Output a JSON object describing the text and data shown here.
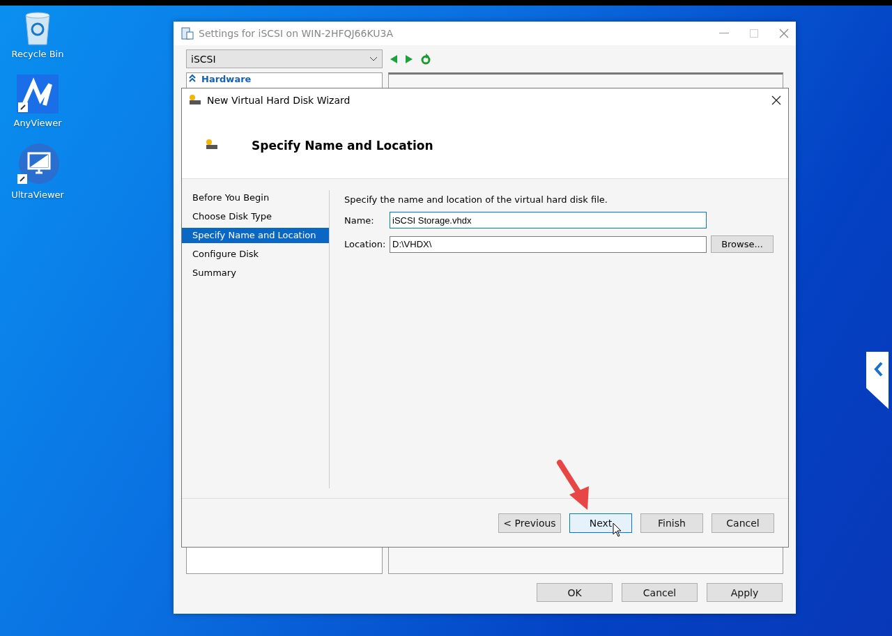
{
  "desktop_icons": [
    {
      "label": "Recycle Bin",
      "kind": "bin"
    },
    {
      "label": "AnyViewer",
      "kind": "anyviewer"
    },
    {
      "label": "UltraViewer",
      "kind": "ultraviewer"
    }
  ],
  "settings_window": {
    "title": "Settings for iSCSI on WIN-2HFQJ66KU3A",
    "selector": "iSCSI",
    "tree_heading": "Hardware",
    "buttons": [
      "OK",
      "Cancel",
      "Apply"
    ]
  },
  "wizard": {
    "title": "New Virtual Hard Disk Wizard",
    "heading": "Specify Name and Location",
    "steps": [
      {
        "label": "Before You Begin",
        "selected": false
      },
      {
        "label": "Choose Disk Type",
        "selected": false
      },
      {
        "label": "Specify Name and Location",
        "selected": true
      },
      {
        "label": "Configure Disk",
        "selected": false
      },
      {
        "label": "Summary",
        "selected": false
      }
    ],
    "instruction": "Specify the name and location of the virtual hard disk file.",
    "fields": [
      {
        "label": "Name:",
        "value": "iSCSI Storage.vhdx",
        "focused": true
      },
      {
        "label": "Location:",
        "value": "D:\\VHDX\\",
        "focused": false
      }
    ],
    "browse": "Browse...",
    "buttons": [
      {
        "label": "< Previous",
        "default": false
      },
      {
        "label": "Next",
        "default": true
      },
      {
        "label": "Finish",
        "default": false
      },
      {
        "label": "Cancel",
        "default": false
      }
    ]
  }
}
